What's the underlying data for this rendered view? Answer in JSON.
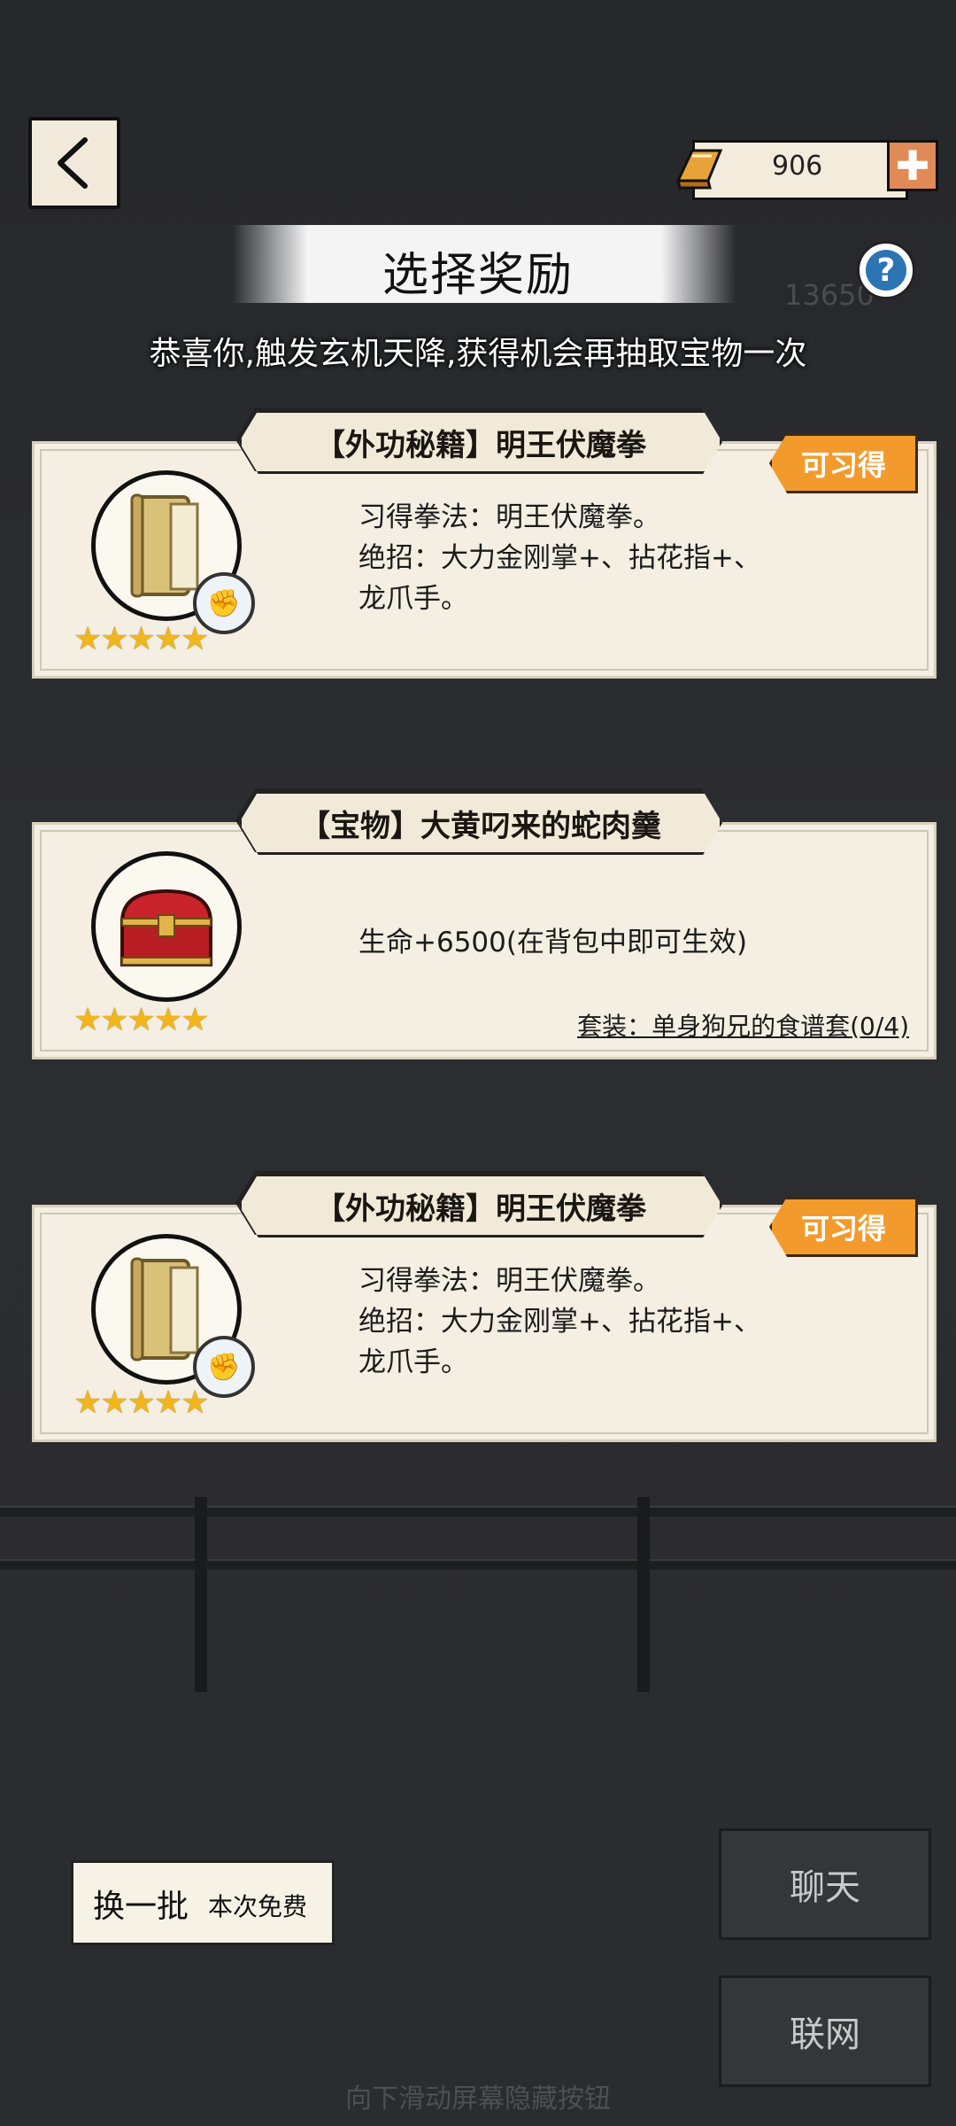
{
  "header": {
    "gold_amount": "906",
    "title": "选择奖励",
    "help_label": "?",
    "background_score": "13650",
    "subtitle": "恭喜你,触发玄机天降,获得机会再抽取宝物一次"
  },
  "cards": [
    {
      "title": "【外功秘籍】明王伏魔拳",
      "badge": "可习得",
      "stars": "★★★★★",
      "icon": "scroll-icon",
      "desc_lines": [
        "习得拳法：明王伏魔拳。",
        "绝招：大力金刚掌+、拈花指+、",
        "龙爪手。"
      ]
    },
    {
      "title": "【宝物】大黄叼来的蛇肉羹",
      "stars": "★★★★★",
      "icon": "treasure-chest-icon",
      "desc_lines": [
        "生命+6500(在背包中即可生效)"
      ],
      "set_link": "套装：单身狗兄的食谱套(0/4)"
    },
    {
      "title": "【外功秘籍】明王伏魔拳",
      "badge": "可习得",
      "stars": "★★★★★",
      "icon": "scroll-icon",
      "desc_lines": [
        "习得拳法：明王伏魔拳。",
        "绝招：大力金刚掌+、拈花指+、",
        "龙爪手。"
      ]
    }
  ],
  "footer": {
    "refresh_label": "换一批",
    "refresh_note": "本次免费",
    "chat_label": "聊天",
    "network_label": "联网",
    "hint": "向下滑动屏幕隐藏按钮"
  },
  "colors": {
    "badge": "#f39a2d",
    "card_bg": "#f4efe2",
    "gold_plus": "#e08a58",
    "help_blue": "#2d74b3",
    "star": "#f2b51e"
  }
}
